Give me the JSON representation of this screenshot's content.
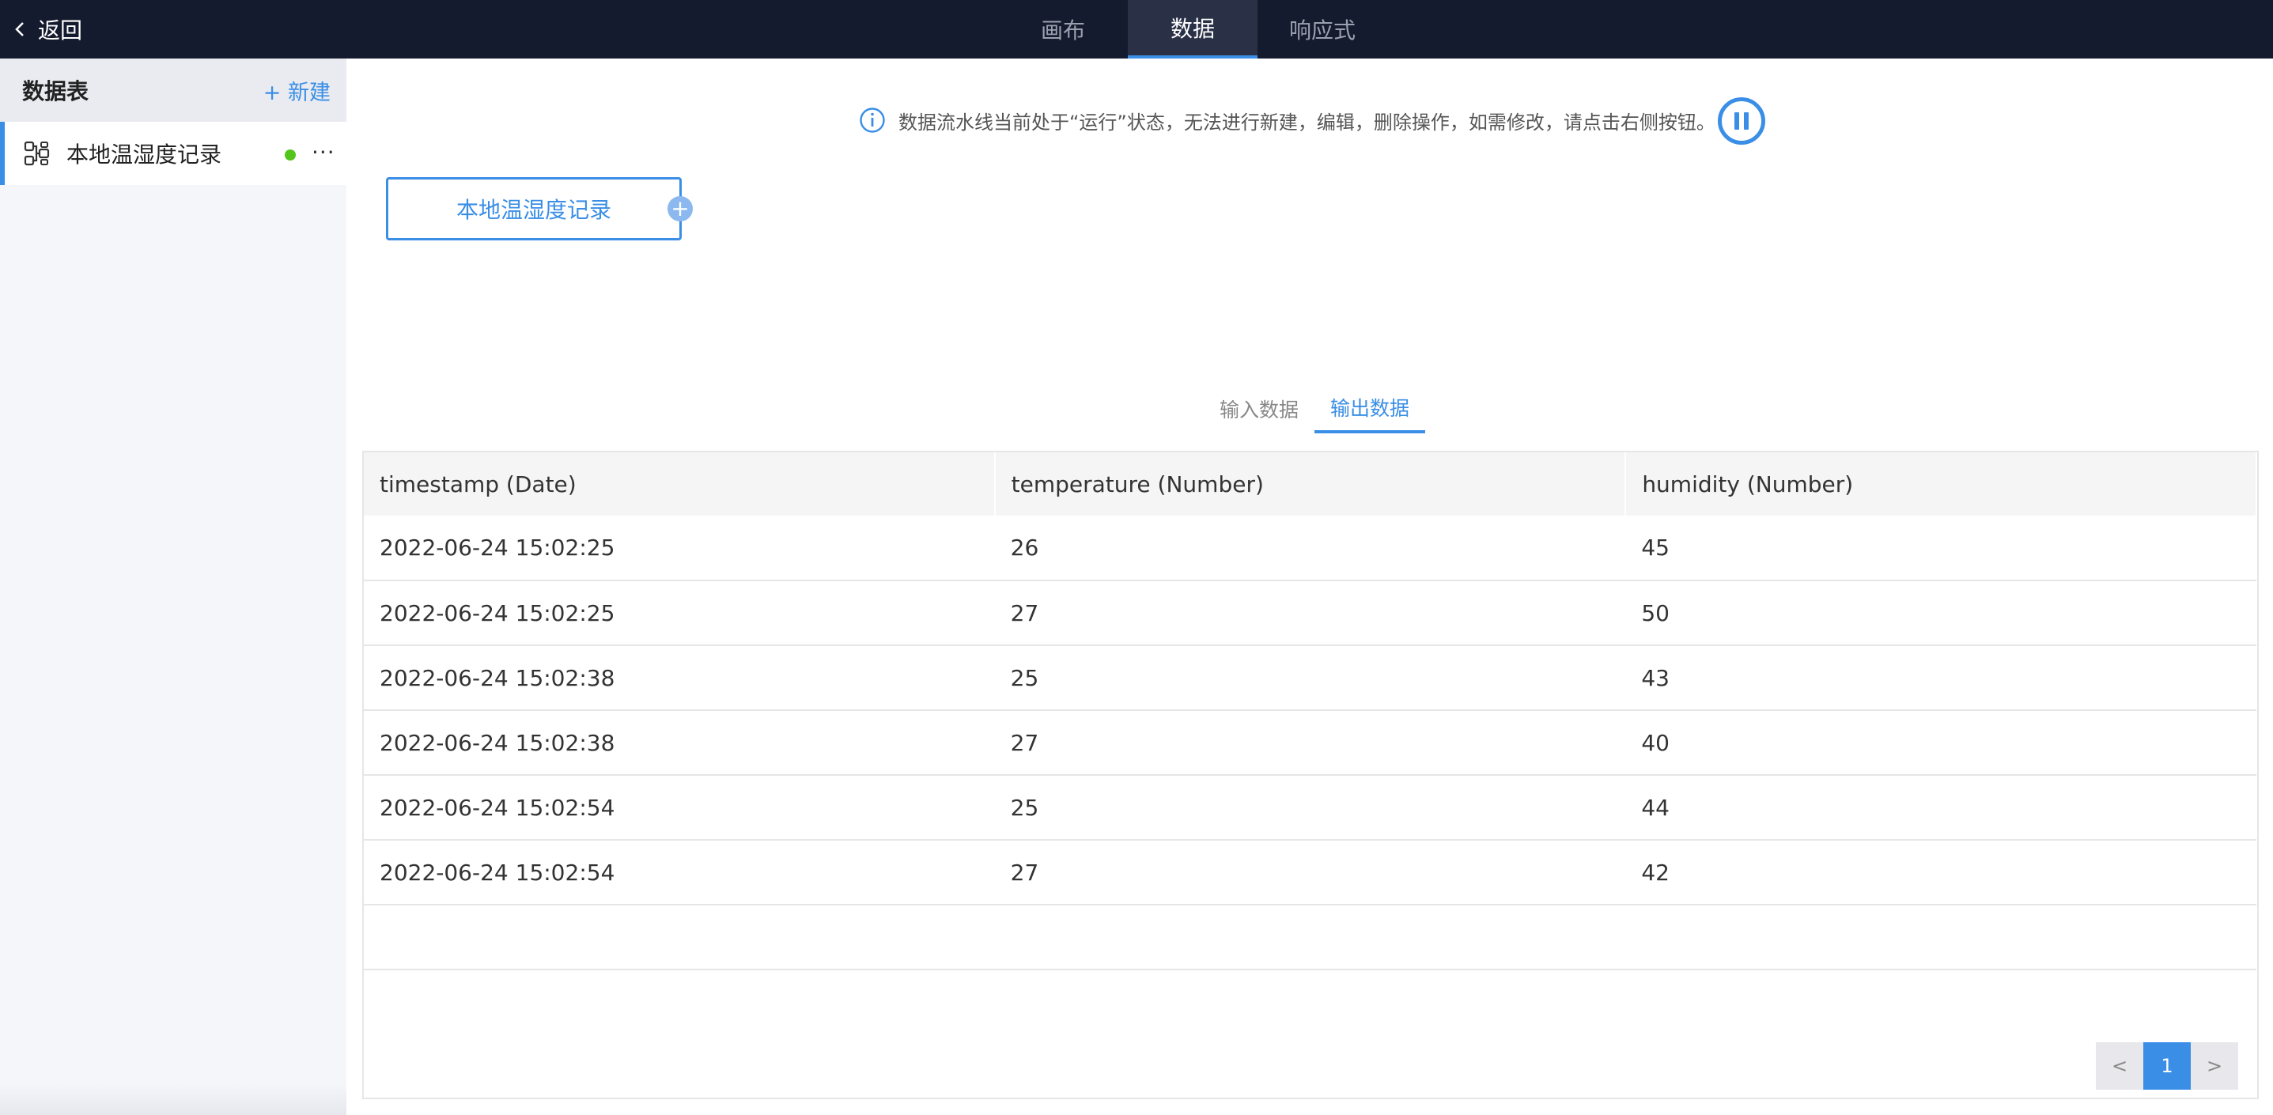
{
  "header": {
    "back_label": "返回",
    "tabs": [
      {
        "label": "画布",
        "active": false
      },
      {
        "label": "数据",
        "active": true
      },
      {
        "label": "响应式",
        "active": false
      }
    ]
  },
  "sidebar": {
    "title": "数据表",
    "new_label": "+ 新建",
    "items": [
      {
        "label": "本地温湿度记录",
        "status_color": "#52c41a",
        "more": "···"
      }
    ]
  },
  "notice": {
    "text": "数据流水线当前处于“运行”状态，无法进行新建，编辑，删除操作，如需修改，请点击右侧按钮。"
  },
  "canvas": {
    "node_label": "本地温湿度记录",
    "add_symbol": "+"
  },
  "data_tabs": [
    {
      "label": "输入数据",
      "active": false
    },
    {
      "label": "输出数据",
      "active": true
    }
  ],
  "table": {
    "columns": [
      "timestamp (Date)",
      "temperature (Number)",
      "humidity (Number)"
    ],
    "rows": [
      [
        "2022-06-24 15:02:25",
        "26",
        "45"
      ],
      [
        "2022-06-24 15:02:25",
        "27",
        "50"
      ],
      [
        "2022-06-24 15:02:38",
        "25",
        "43"
      ],
      [
        "2022-06-24 15:02:38",
        "27",
        "40"
      ],
      [
        "2022-06-24 15:02:54",
        "25",
        "44"
      ],
      [
        "2022-06-24 15:02:54",
        "27",
        "42"
      ]
    ]
  },
  "pagination": {
    "prev": "<",
    "current": "1",
    "next": ">"
  },
  "colors": {
    "accent": "#3a8ee6",
    "topbar": "#151b2e",
    "status_ok": "#52c41a"
  }
}
